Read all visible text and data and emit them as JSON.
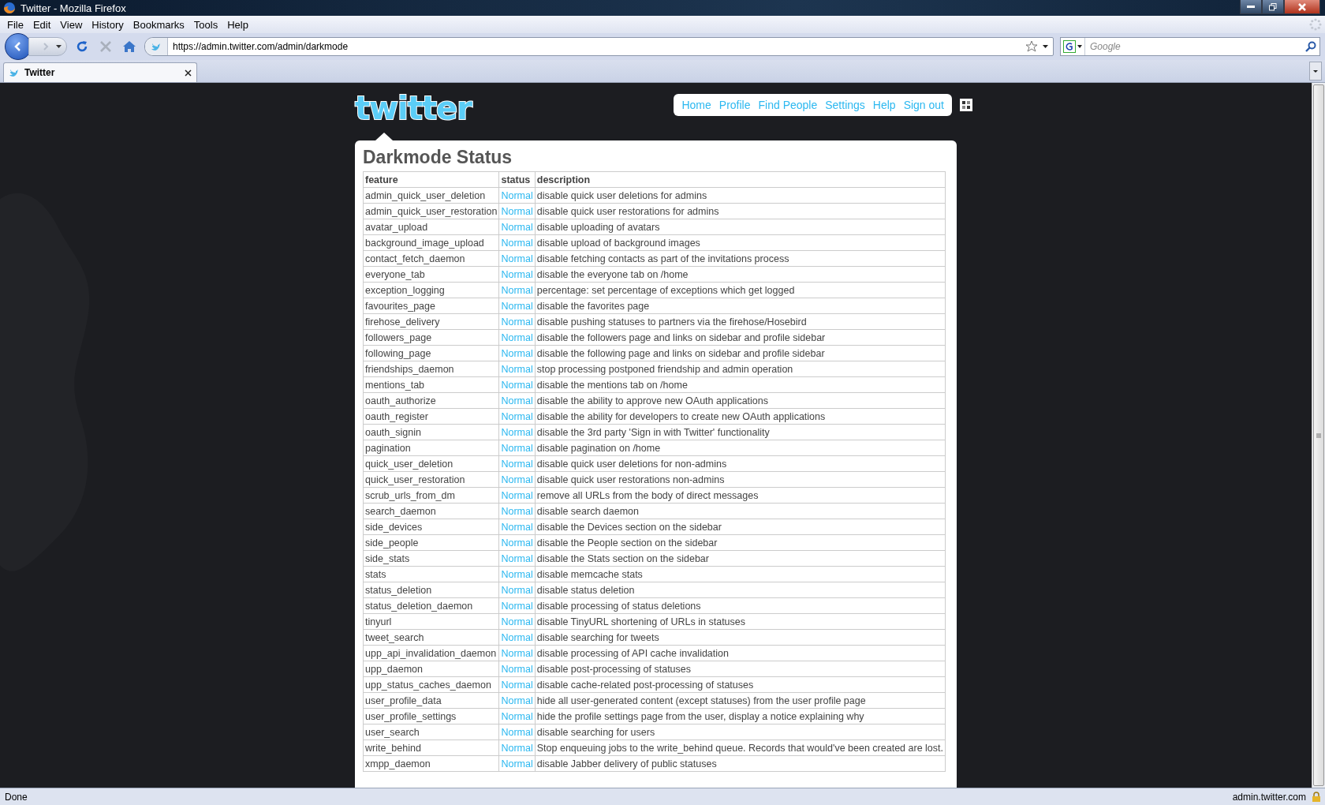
{
  "window": {
    "title": "Twitter - Mozilla Firefox"
  },
  "menu": [
    "File",
    "Edit",
    "View",
    "History",
    "Bookmarks",
    "Tools",
    "Help"
  ],
  "toolbar": {
    "url": "https://admin.twitter.com/admin/darkmode",
    "search_placeholder": "Google",
    "stop_disabled": true,
    "forward_disabled": true
  },
  "tabs": [
    {
      "label": "Twitter",
      "selected": true
    }
  ],
  "page": {
    "logo": "twitter",
    "nav": [
      "Home",
      "Profile",
      "Find People",
      "Settings",
      "Help",
      "Sign out"
    ],
    "title": "Darkmode Status",
    "table": {
      "columns": [
        "feature",
        "status",
        "description"
      ],
      "rows": [
        [
          "admin_quick_user_deletion",
          "Normal",
          "disable quick user deletions for admins"
        ],
        [
          "admin_quick_user_restoration",
          "Normal",
          "disable quick user restorations for admins"
        ],
        [
          "avatar_upload",
          "Normal",
          "disable uploading of avatars"
        ],
        [
          "background_image_upload",
          "Normal",
          "disable upload of background images"
        ],
        [
          "contact_fetch_daemon",
          "Normal",
          "disable fetching contacts as part of the invitations process"
        ],
        [
          "everyone_tab",
          "Normal",
          "disable the everyone tab on /home"
        ],
        [
          "exception_logging",
          "Normal",
          "percentage: set percentage of exceptions which get logged"
        ],
        [
          "favourites_page",
          "Normal",
          "disable the favorites page"
        ],
        [
          "firehose_delivery",
          "Normal",
          "disable pushing statuses to partners via the firehose/Hosebird"
        ],
        [
          "followers_page",
          "Normal",
          "disable the followers page and links on sidebar and profile sidebar"
        ],
        [
          "following_page",
          "Normal",
          "disable the following page and links on sidebar and profile sidebar"
        ],
        [
          "friendships_daemon",
          "Normal",
          "stop processing postponed friendship and admin operation"
        ],
        [
          "mentions_tab",
          "Normal",
          "disable the mentions tab on /home"
        ],
        [
          "oauth_authorize",
          "Normal",
          "disable the ability to approve new OAuth applications"
        ],
        [
          "oauth_register",
          "Normal",
          "disable the ability for developers to create new OAuth applications"
        ],
        [
          "oauth_signin",
          "Normal",
          "disable the 3rd party 'Sign in with Twitter' functionality"
        ],
        [
          "pagination",
          "Normal",
          "disable pagination on /home"
        ],
        [
          "quick_user_deletion",
          "Normal",
          "disable quick user deletions for non-admins"
        ],
        [
          "quick_user_restoration",
          "Normal",
          "disable quick user restorations non-admins"
        ],
        [
          "scrub_urls_from_dm",
          "Normal",
          "remove all URLs from the body of direct messages"
        ],
        [
          "search_daemon",
          "Normal",
          "disable search daemon"
        ],
        [
          "side_devices",
          "Normal",
          "disable the Devices section on the sidebar"
        ],
        [
          "side_people",
          "Normal",
          "disable the People section on the sidebar"
        ],
        [
          "side_stats",
          "Normal",
          "disable the Stats section on the sidebar"
        ],
        [
          "stats",
          "Normal",
          "disable memcache stats"
        ],
        [
          "status_deletion",
          "Normal",
          "disable status deletion"
        ],
        [
          "status_deletion_daemon",
          "Normal",
          "disable processing of status deletions"
        ],
        [
          "tinyurl",
          "Normal",
          "disable TinyURL shortening of URLs in statuses"
        ],
        [
          "tweet_search",
          "Normal",
          "disable searching for tweets"
        ],
        [
          "upp_api_invalidation_daemon",
          "Normal",
          "disable processing of API cache invalidation"
        ],
        [
          "upp_daemon",
          "Normal",
          "disable post-processing of statuses"
        ],
        [
          "upp_status_caches_daemon",
          "Normal",
          "disable cache-related post-processing of statuses"
        ],
        [
          "user_profile_data",
          "Normal",
          "hide all user-generated content (except statuses) from the user profile page"
        ],
        [
          "user_profile_settings",
          "Normal",
          "hide the profile settings page from the user, display a notice explaining why"
        ],
        [
          "user_search",
          "Normal",
          "disable searching for users"
        ],
        [
          "write_behind",
          "Normal",
          "Stop enqueuing jobs to the write_behind queue. Records that would've been created are lost."
        ],
        [
          "xmpp_daemon",
          "Normal",
          "disable Jabber delivery of public statuses"
        ]
      ]
    }
  },
  "status_bar": {
    "text": "Done",
    "host": "admin.twitter.com"
  }
}
